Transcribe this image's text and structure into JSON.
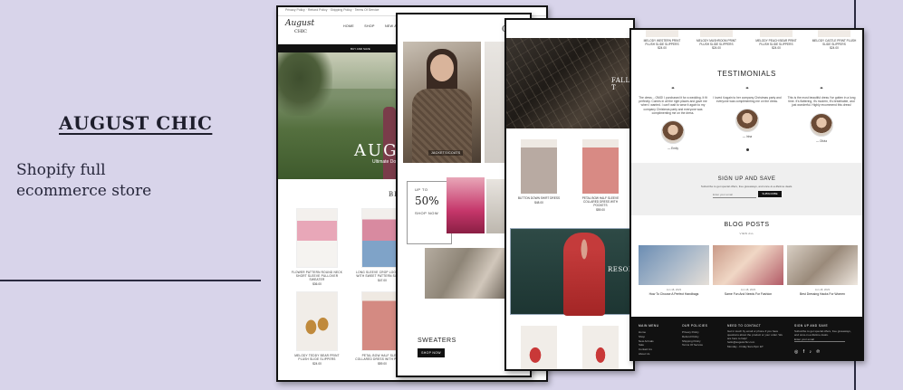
{
  "brand": {
    "title": "AUGUST CHIC",
    "subtitle": "Shopify full ecommerce store"
  },
  "card1": {
    "toplinks": "Privacy Policy · Refund Policy · Shipping Policy · Terms Of Service",
    "logo_line1": "August",
    "logo_line2": "CHIC",
    "nav": [
      "HOME",
      "SHOP",
      "NEW ARRIVALS"
    ],
    "announce": "BUY AND SAVE",
    "hero_title": "AUGU",
    "hero_sub": "Ultimate Do",
    "section": "BE",
    "products": [
      {
        "name": "FLOWER PATTERN ROUND NECK SHORT SLEEVE PULLOVER SWEATER",
        "price": "$36.00"
      },
      {
        "name": "LONG SLEEVE CROP LOOSE KNIT WITH SWEET PATTERN SWEATER",
        "price": "$47.00"
      },
      {
        "name": "MELODY TEDDY BEAR PRINT PLUSH SLIDE SLIPPERS",
        "price": "$24.00"
      },
      {
        "name": "PETAL BOW HALF SLEEVE COLLARED DRESS WITH POCKETS",
        "price": "$59.00"
      }
    ]
  },
  "card2": {
    "heading": "C",
    "tag": "JACKETS/COATS",
    "sale_line1": "UP TO",
    "sale_value": "50%",
    "sale_line2": "SHOP NOW",
    "sweaters": "SWEATERS",
    "button": "SHOP NOW"
  },
  "card3": {
    "hero_title": "FALL T",
    "products": [
      {
        "name": "BUTTON DOWN SHIRT DRESS",
        "price": "$48.00"
      },
      {
        "name": "PETAL BOW HALF SLEEVE COLLARED DRESS WITH POCKETS",
        "price": "$59.00"
      }
    ],
    "resort": "RESORT"
  },
  "card4": {
    "products": [
      {
        "name": "MELODY WESTERN PRINT PLUSH SLIDE SLIPPERS",
        "price": "$24.00"
      },
      {
        "name": "MELODY MUSHROOM PRINT PLUSH SLIDE SLIPPERS",
        "price": "$24.00"
      },
      {
        "name": "MELODY PEACH BEAR PRINT PLUSH SLIDE SLIPPERS",
        "price": "$24.00"
      },
      {
        "name": "MELODY CASTLE PRINT PLUSH SLIDE SLIPPERS",
        "price": "$24.00"
      }
    ],
    "testimonials_title": "TESTIMONIALS",
    "testimonials": [
      {
        "text": "The dress... OMG! I purchased it for a wedding. It fit perfectly. Comes in all the right places and gave me when I wanted. I can't wait to wear it again to my company Christmas party and everyone was complimenting me on the dress.",
        "who": "— Emily"
      },
      {
        "text": "I loved it again to her company Christmas party and everyone was complimenting me on the dress.",
        "who": "— Irina"
      },
      {
        "text": "This is the most beautiful dress I've gotten in a long time. It's flattering, it's modern, it's breathable, and just wonderful. Highly recommend this dress!",
        "who": "— Olivia"
      }
    ],
    "signup_title": "SIGN UP AND SAVE",
    "signup_desc": "Subscribe to get special offers, free giveaways, and once-in-a-lifetime deals.",
    "signup_placeholder": "Enter your email",
    "signup_button": "SUBSCRIBE",
    "blog_title": "BLOG POSTS",
    "blog_sub": "VIEW ALL",
    "posts": [
      {
        "date": "Jun 18, 2023",
        "title": "How To Choose A Perfect Handbags"
      },
      {
        "date": "Jun 18, 2023",
        "title": "Same Fun And Needs For Fashion"
      },
      {
        "date": "Jun 18, 2023",
        "title": "Best Dressing Hacks For Women"
      }
    ],
    "footer": {
      "col1_title": "MAIN MENU",
      "col1_items": [
        "Home",
        "Shop",
        "New Arrivals",
        "Sale",
        "Contact Us",
        "About Us"
      ],
      "col2_title": "OUR POLICIES",
      "col2_items": [
        "Privacy Policy",
        "Refund Policy",
        "Shipping Policy",
        "Terms Of Service"
      ],
      "col3_title": "NEED TO CONTACT",
      "col3_items": [
        "Get in touch by email or phone if you have questions about the product or your order. We are here to help!",
        "hello@augustchic.com",
        "Monday - Friday 9am-5pm ET"
      ],
      "col4_title": "SIGN UP AND SAVE",
      "col4_items": [
        "Subscribe to get special offers, free giveaways, and once-in-a-lifetime deals.",
        "Enter your email"
      ],
      "social": "◎ f ♪ ℗"
    }
  }
}
